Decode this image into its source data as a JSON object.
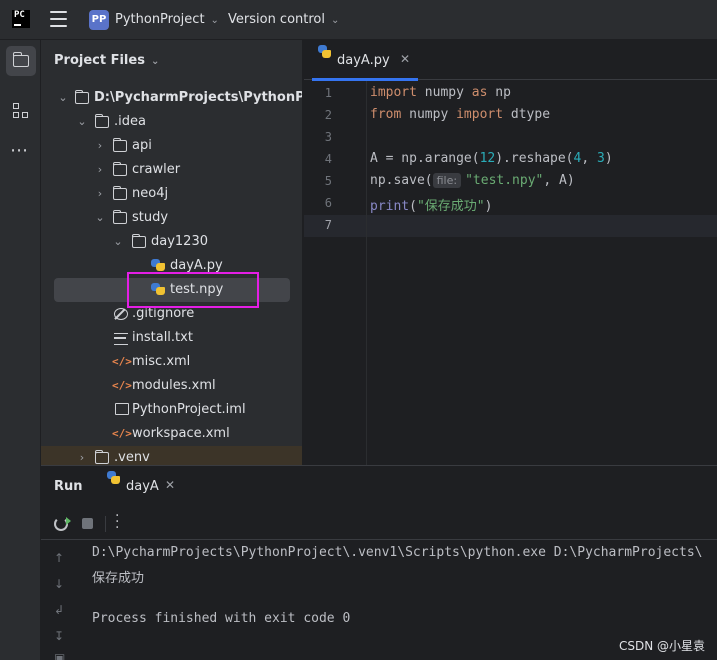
{
  "titlebar": {
    "logo_text": "PC",
    "project_badge": "PP",
    "project_name": "PythonProject",
    "version_control": "Version control"
  },
  "project_panel": {
    "title": "Project Files",
    "tree": [
      {
        "label": "D:\\PycharmProjects\\PythonProject",
        "icon": "folder-icon",
        "expanded": true
      },
      {
        "label": ".idea",
        "icon": "folder-icon",
        "expanded": true
      },
      {
        "label": "api",
        "icon": "folder-icon",
        "expanded": false
      },
      {
        "label": "crawler",
        "icon": "folder-icon",
        "expanded": false
      },
      {
        "label": "neo4j",
        "icon": "folder-icon",
        "expanded": false
      },
      {
        "label": "study",
        "icon": "folder-icon",
        "expanded": true
      },
      {
        "label": "day1230",
        "icon": "folder-icon",
        "expanded": true
      },
      {
        "label": "dayA.py",
        "icon": "python-file-icon"
      },
      {
        "label": "test.npy",
        "icon": "python-file-icon",
        "selected": true
      },
      {
        "label": ".gitignore",
        "icon": "ignore-file-icon"
      },
      {
        "label": "install.txt",
        "icon": "text-file-icon"
      },
      {
        "label": "misc.xml",
        "icon": "xml-file-icon"
      },
      {
        "label": "modules.xml",
        "icon": "xml-file-icon"
      },
      {
        "label": "PythonProject.iml",
        "icon": "iml-file-icon"
      },
      {
        "label": "workspace.xml",
        "icon": "xml-file-icon"
      },
      {
        "label": ".venv",
        "icon": "folder-icon",
        "expanded": false
      }
    ]
  },
  "editor": {
    "tab_label": "dayA.py",
    "line_numbers": [
      "1",
      "2",
      "3",
      "4",
      "5",
      "6",
      "7"
    ],
    "param_hint": "file:",
    "lines": {
      "l1_kw1": "import",
      "l1_mod": " numpy ",
      "l1_kw2": "as",
      "l1_alias": " np",
      "l2_kw1": "from",
      "l2_mod": " numpy ",
      "l2_kw2": "import",
      "l2_name": " dtype",
      "l4_a": "A = np.arange(",
      "l4_n1": "12",
      "l4_b": ").reshape(",
      "l4_n2": "4",
      "l4_c": ", ",
      "l4_n3": "3",
      "l4_d": ")",
      "l5_a": "np.save(",
      "l5_str": "\"test.npy\"",
      "l5_b": ", A)",
      "l6_fn": "print",
      "l6_a": "(",
      "l6_str": "\"保存成功\"",
      "l6_b": ")"
    }
  },
  "run_panel": {
    "title": "Run",
    "tab_label": "dayA",
    "console": [
      "D:\\PycharmProjects\\PythonProject\\.venv1\\Scripts\\python.exe D:\\PycharmProjects\\",
      "保存成功",
      "",
      "Process finished with exit code 0"
    ]
  },
  "watermark": "CSDN @小星袁",
  "colors": {
    "accent": "#3574f0",
    "highlight_box": "#e41ee6",
    "keyword": "#cf8e6d",
    "string": "#6aab73",
    "number": "#2aacb8"
  }
}
